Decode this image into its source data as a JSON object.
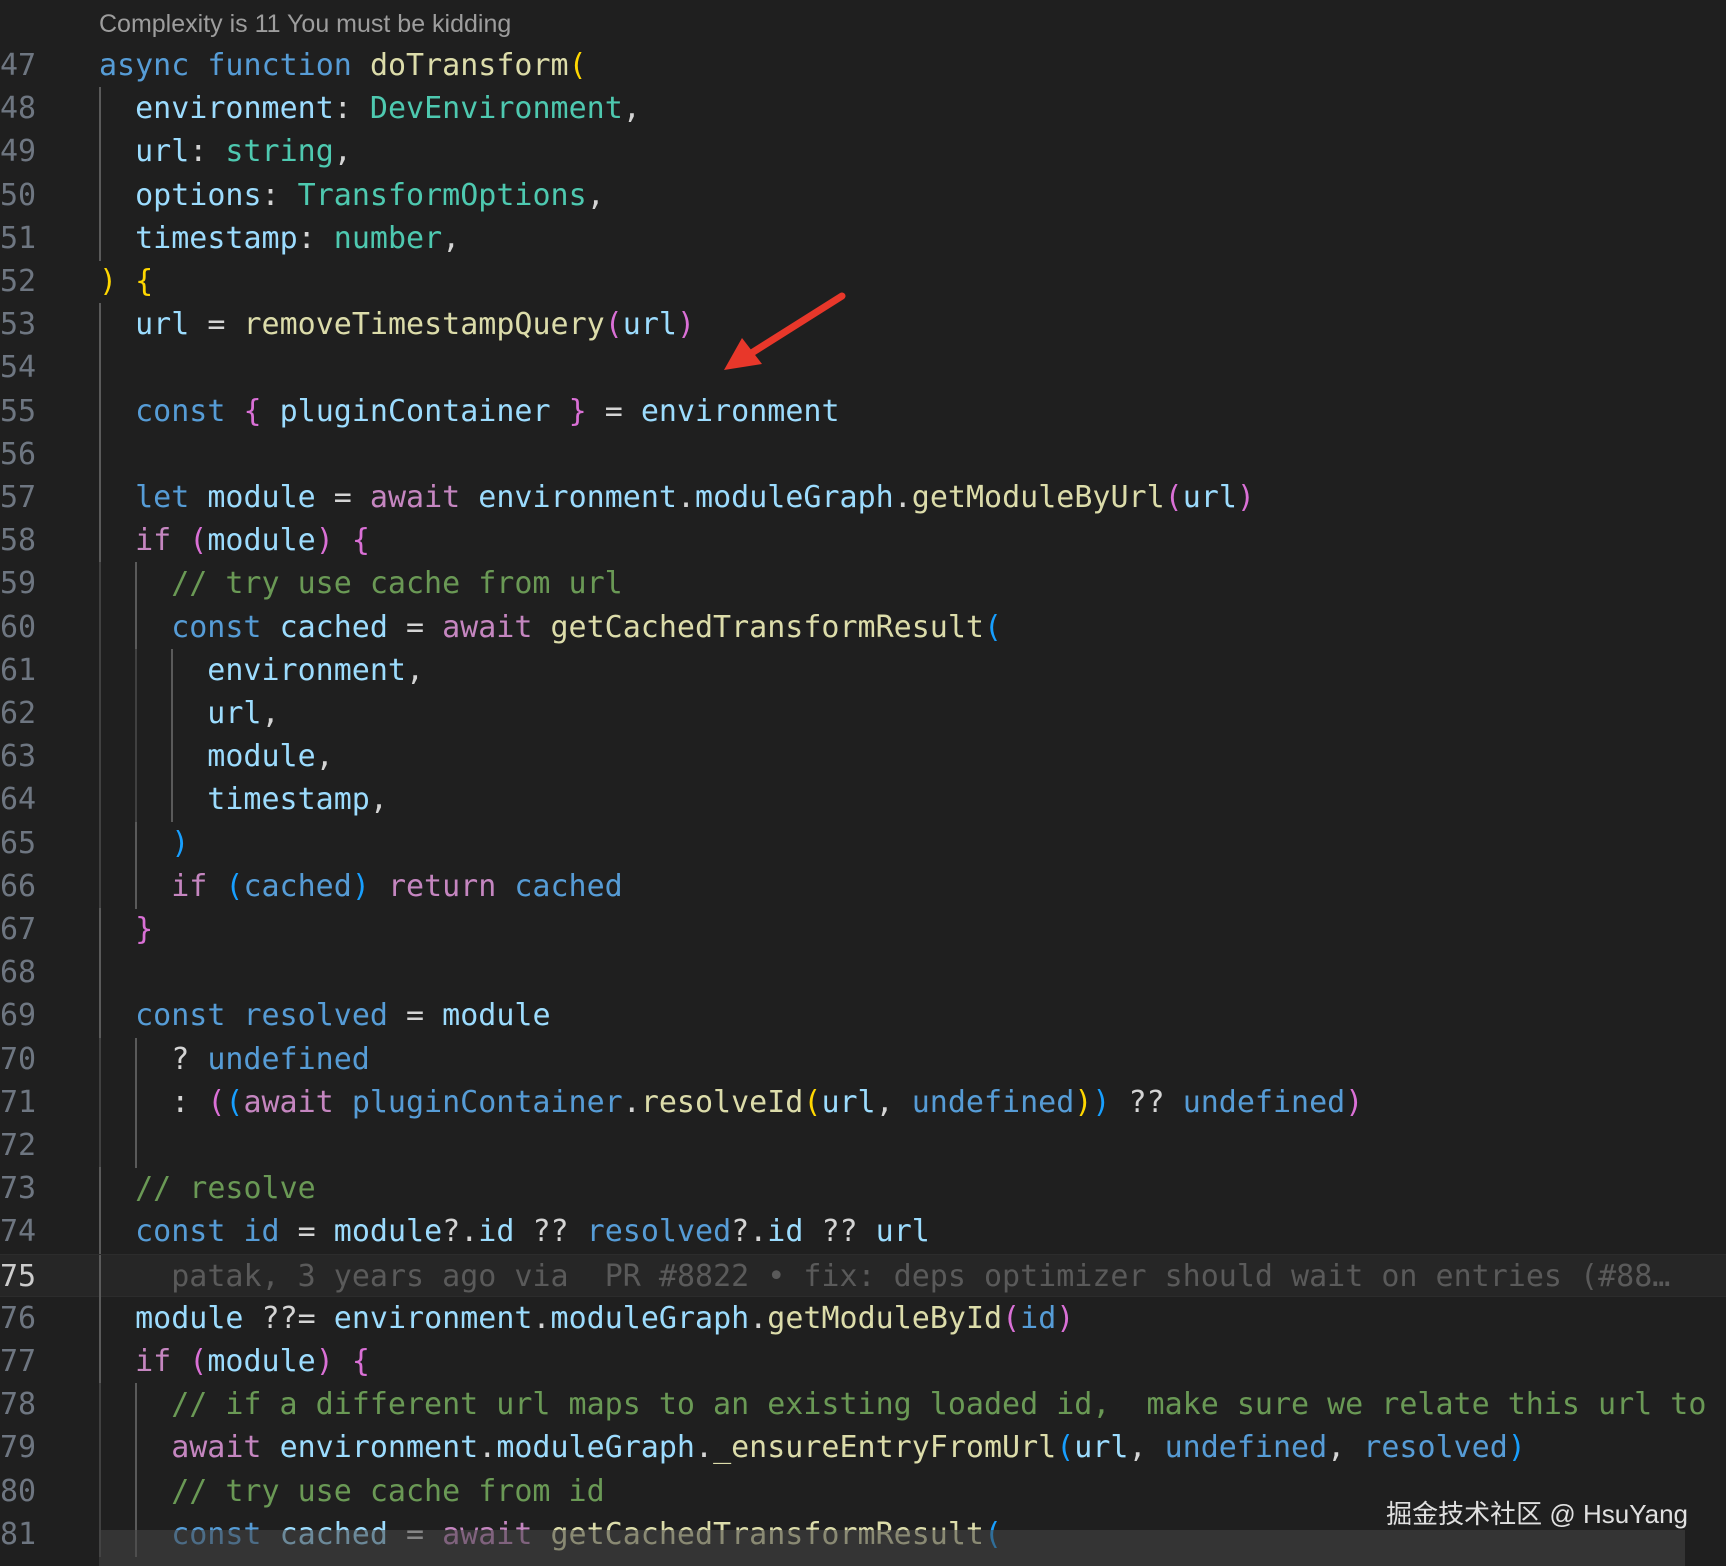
{
  "codelens": "Complexity is 11 You must be kidding",
  "active_line": 75,
  "watermark": "掘金技术社区 @ HsuYang",
  "colors": {
    "background": "#1f1f1f",
    "keyword": "#569cd6",
    "control": "#c586c0",
    "function": "#dcdcaa",
    "type": "#4ec9b0",
    "variable": "#9cdcfe",
    "comment": "#6a9955",
    "plain": "#d4d4d4",
    "bracket_gold": "#ffd700",
    "bracket_pink": "#da70d6",
    "bracket_blue": "#179fff",
    "arrow": "#e8372a"
  },
  "lines": [
    {
      "n": 47,
      "indent": 0,
      "tokens": [
        {
          "t": "async",
          "c": "keyword"
        },
        {
          "t": " ",
          "c": "plain"
        },
        {
          "t": "function",
          "c": "keyword"
        },
        {
          "t": " ",
          "c": "plain"
        },
        {
          "t": "doTransform",
          "c": "function"
        },
        {
          "t": "(",
          "c": "bracket_gold"
        }
      ]
    },
    {
      "n": 48,
      "indent": 1,
      "tokens": [
        {
          "t": "environment",
          "c": "variable"
        },
        {
          "t": ": ",
          "c": "plain"
        },
        {
          "t": "DevEnvironment",
          "c": "type"
        },
        {
          "t": ",",
          "c": "plain"
        }
      ]
    },
    {
      "n": 49,
      "indent": 1,
      "tokens": [
        {
          "t": "url",
          "c": "variable"
        },
        {
          "t": ": ",
          "c": "plain"
        },
        {
          "t": "string",
          "c": "type"
        },
        {
          "t": ",",
          "c": "plain"
        }
      ]
    },
    {
      "n": 50,
      "indent": 1,
      "tokens": [
        {
          "t": "options",
          "c": "variable"
        },
        {
          "t": ": ",
          "c": "plain"
        },
        {
          "t": "TransformOptions",
          "c": "type"
        },
        {
          "t": ",",
          "c": "plain"
        }
      ]
    },
    {
      "n": 51,
      "indent": 1,
      "tokens": [
        {
          "t": "timestamp",
          "c": "variable"
        },
        {
          "t": ": ",
          "c": "plain"
        },
        {
          "t": "number",
          "c": "type"
        },
        {
          "t": ",",
          "c": "plain"
        }
      ]
    },
    {
      "n": 52,
      "indent": 0,
      "tokens": [
        {
          "t": ")",
          "c": "bracket_gold"
        },
        {
          "t": " ",
          "c": "plain"
        },
        {
          "t": "{",
          "c": "bracket_gold"
        }
      ]
    },
    {
      "n": 53,
      "indent": 1,
      "tokens": [
        {
          "t": "url",
          "c": "variable"
        },
        {
          "t": " = ",
          "c": "plain"
        },
        {
          "t": "removeTimestampQuery",
          "c": "function"
        },
        {
          "t": "(",
          "c": "bracket_pink"
        },
        {
          "t": "url",
          "c": "variable"
        },
        {
          "t": ")",
          "c": "bracket_pink"
        }
      ]
    },
    {
      "n": 54,
      "indent": 1,
      "tokens": []
    },
    {
      "n": 55,
      "indent": 1,
      "tokens": [
        {
          "t": "const",
          "c": "keyword"
        },
        {
          "t": " ",
          "c": "plain"
        },
        {
          "t": "{",
          "c": "bracket_pink"
        },
        {
          "t": " pluginContainer ",
          "c": "variable"
        },
        {
          "t": "}",
          "c": "bracket_pink"
        },
        {
          "t": " = ",
          "c": "plain"
        },
        {
          "t": "environment",
          "c": "variable"
        }
      ]
    },
    {
      "n": 56,
      "indent": 1,
      "tokens": []
    },
    {
      "n": 57,
      "indent": 1,
      "tokens": [
        {
          "t": "let",
          "c": "keyword"
        },
        {
          "t": " ",
          "c": "plain"
        },
        {
          "t": "module",
          "c": "variable"
        },
        {
          "t": " = ",
          "c": "plain"
        },
        {
          "t": "await",
          "c": "control"
        },
        {
          "t": " ",
          "c": "plain"
        },
        {
          "t": "environment",
          "c": "variable"
        },
        {
          "t": ".",
          "c": "plain"
        },
        {
          "t": "moduleGraph",
          "c": "variable"
        },
        {
          "t": ".",
          "c": "plain"
        },
        {
          "t": "getModuleByUrl",
          "c": "function"
        },
        {
          "t": "(",
          "c": "bracket_pink"
        },
        {
          "t": "url",
          "c": "variable"
        },
        {
          "t": ")",
          "c": "bracket_pink"
        }
      ]
    },
    {
      "n": 58,
      "indent": 1,
      "tokens": [
        {
          "t": "if",
          "c": "control"
        },
        {
          "t": " ",
          "c": "plain"
        },
        {
          "t": "(",
          "c": "bracket_pink"
        },
        {
          "t": "module",
          "c": "variable"
        },
        {
          "t": ")",
          "c": "bracket_pink"
        },
        {
          "t": " ",
          "c": "plain"
        },
        {
          "t": "{",
          "c": "bracket_pink"
        }
      ]
    },
    {
      "n": 59,
      "indent": 2,
      "tokens": [
        {
          "t": "// try use cache from url",
          "c": "comment"
        }
      ]
    },
    {
      "n": 60,
      "indent": 2,
      "tokens": [
        {
          "t": "const",
          "c": "keyword"
        },
        {
          "t": " ",
          "c": "plain"
        },
        {
          "t": "cached",
          "c": "variable"
        },
        {
          "t": " = ",
          "c": "plain"
        },
        {
          "t": "await",
          "c": "control"
        },
        {
          "t": " ",
          "c": "plain"
        },
        {
          "t": "getCachedTransformResult",
          "c": "function"
        },
        {
          "t": "(",
          "c": "bracket_blue"
        }
      ]
    },
    {
      "n": 61,
      "indent": 3,
      "tokens": [
        {
          "t": "environment",
          "c": "variable"
        },
        {
          "t": ",",
          "c": "plain"
        }
      ]
    },
    {
      "n": 62,
      "indent": 3,
      "tokens": [
        {
          "t": "url",
          "c": "variable"
        },
        {
          "t": ",",
          "c": "plain"
        }
      ]
    },
    {
      "n": 63,
      "indent": 3,
      "tokens": [
        {
          "t": "module",
          "c": "variable"
        },
        {
          "t": ",",
          "c": "plain"
        }
      ]
    },
    {
      "n": 64,
      "indent": 3,
      "tokens": [
        {
          "t": "timestamp",
          "c": "variable"
        },
        {
          "t": ",",
          "c": "plain"
        }
      ]
    },
    {
      "n": 65,
      "indent": 2,
      "tokens": [
        {
          "t": ")",
          "c": "bracket_blue"
        }
      ]
    },
    {
      "n": 66,
      "indent": 2,
      "tokens": [
        {
          "t": "if",
          "c": "control"
        },
        {
          "t": " ",
          "c": "plain"
        },
        {
          "t": "(",
          "c": "bracket_blue"
        },
        {
          "t": "cached",
          "c": "keyword"
        },
        {
          "t": ")",
          "c": "bracket_blue"
        },
        {
          "t": " ",
          "c": "plain"
        },
        {
          "t": "return",
          "c": "control"
        },
        {
          "t": " ",
          "c": "plain"
        },
        {
          "t": "cached",
          "c": "keyword"
        }
      ]
    },
    {
      "n": 67,
      "indent": 1,
      "tokens": [
        {
          "t": "}",
          "c": "bracket_pink"
        }
      ]
    },
    {
      "n": 68,
      "indent": 1,
      "tokens": []
    },
    {
      "n": 69,
      "indent": 1,
      "tokens": [
        {
          "t": "const",
          "c": "keyword"
        },
        {
          "t": " ",
          "c": "plain"
        },
        {
          "t": "resolved",
          "c": "keyword"
        },
        {
          "t": " = ",
          "c": "plain"
        },
        {
          "t": "module",
          "c": "variable"
        }
      ]
    },
    {
      "n": 70,
      "indent": 2,
      "tokens": [
        {
          "t": "? ",
          "c": "plain"
        },
        {
          "t": "undefined",
          "c": "keyword"
        }
      ]
    },
    {
      "n": 71,
      "indent": 2,
      "tokens": [
        {
          "t": ": ",
          "c": "plain"
        },
        {
          "t": "(",
          "c": "bracket_pink"
        },
        {
          "t": "(",
          "c": "bracket_blue"
        },
        {
          "t": "await",
          "c": "control"
        },
        {
          "t": " ",
          "c": "plain"
        },
        {
          "t": "pluginContainer",
          "c": "keyword"
        },
        {
          "t": ".",
          "c": "plain"
        },
        {
          "t": "resolveId",
          "c": "function"
        },
        {
          "t": "(",
          "c": "bracket_gold"
        },
        {
          "t": "url",
          "c": "variable"
        },
        {
          "t": ", ",
          "c": "plain"
        },
        {
          "t": "undefined",
          "c": "keyword"
        },
        {
          "t": ")",
          "c": "bracket_gold"
        },
        {
          "t": ")",
          "c": "bracket_blue"
        },
        {
          "t": " ?? ",
          "c": "plain"
        },
        {
          "t": "undefined",
          "c": "keyword"
        },
        {
          "t": ")",
          "c": "bracket_pink"
        }
      ]
    },
    {
      "n": 72,
      "indent": 2,
      "tokens": []
    },
    {
      "n": 73,
      "indent": 1,
      "tokens": [
        {
          "t": "// resolve",
          "c": "comment"
        }
      ]
    },
    {
      "n": 74,
      "indent": 1,
      "tokens": [
        {
          "t": "const",
          "c": "keyword"
        },
        {
          "t": " ",
          "c": "plain"
        },
        {
          "t": "id",
          "c": "keyword"
        },
        {
          "t": " = ",
          "c": "plain"
        },
        {
          "t": "module",
          "c": "variable"
        },
        {
          "t": "?.",
          "c": "plain"
        },
        {
          "t": "id",
          "c": "variable"
        },
        {
          "t": " ?? ",
          "c": "plain"
        },
        {
          "t": "resolved",
          "c": "keyword"
        },
        {
          "t": "?.",
          "c": "plain"
        },
        {
          "t": "id",
          "c": "variable"
        },
        {
          "t": " ?? ",
          "c": "plain"
        },
        {
          "t": "url",
          "c": "variable"
        }
      ]
    },
    {
      "n": 75,
      "indent": 1,
      "tokens": [
        {
          "t": "  patak, 3 years ago via  PR #8822 • fix: deps optimizer should wait on entries (#88…",
          "c": "blame"
        }
      ]
    },
    {
      "n": 76,
      "indent": 1,
      "tokens": [
        {
          "t": "module",
          "c": "variable"
        },
        {
          "t": " ??= ",
          "c": "plain"
        },
        {
          "t": "environment",
          "c": "variable"
        },
        {
          "t": ".",
          "c": "plain"
        },
        {
          "t": "moduleGraph",
          "c": "variable"
        },
        {
          "t": ".",
          "c": "plain"
        },
        {
          "t": "getModuleById",
          "c": "function"
        },
        {
          "t": "(",
          "c": "bracket_pink"
        },
        {
          "t": "id",
          "c": "keyword"
        },
        {
          "t": ")",
          "c": "bracket_pink"
        }
      ]
    },
    {
      "n": 77,
      "indent": 1,
      "tokens": [
        {
          "t": "if",
          "c": "control"
        },
        {
          "t": " ",
          "c": "plain"
        },
        {
          "t": "(",
          "c": "bracket_pink"
        },
        {
          "t": "module",
          "c": "variable"
        },
        {
          "t": ")",
          "c": "bracket_pink"
        },
        {
          "t": " ",
          "c": "plain"
        },
        {
          "t": "{",
          "c": "bracket_pink"
        }
      ]
    },
    {
      "n": 78,
      "indent": 2,
      "tokens": [
        {
          "t": "// if a different url maps to an existing loaded id,  make sure we relate this url to the",
          "c": "comment"
        }
      ]
    },
    {
      "n": 79,
      "indent": 2,
      "tokens": [
        {
          "t": "await",
          "c": "control"
        },
        {
          "t": " ",
          "c": "plain"
        },
        {
          "t": "environment",
          "c": "variable"
        },
        {
          "t": ".",
          "c": "plain"
        },
        {
          "t": "moduleGraph",
          "c": "variable"
        },
        {
          "t": ".",
          "c": "plain"
        },
        {
          "t": "_ensureEntryFromUrl",
          "c": "function"
        },
        {
          "t": "(",
          "c": "bracket_blue"
        },
        {
          "t": "url",
          "c": "variable"
        },
        {
          "t": ", ",
          "c": "plain"
        },
        {
          "t": "undefined",
          "c": "keyword"
        },
        {
          "t": ", ",
          "c": "plain"
        },
        {
          "t": "resolved",
          "c": "keyword"
        },
        {
          "t": ")",
          "c": "bracket_blue"
        }
      ]
    },
    {
      "n": 80,
      "indent": 2,
      "tokens": [
        {
          "t": "// try use cache from id",
          "c": "comment"
        }
      ]
    },
    {
      "n": 81,
      "indent": 2,
      "tokens": [
        {
          "t": "const",
          "c": "keyword"
        },
        {
          "t": " ",
          "c": "plain"
        },
        {
          "t": "cached",
          "c": "variable"
        },
        {
          "t": " = ",
          "c": "plain"
        },
        {
          "t": "await",
          "c": "control"
        },
        {
          "t": " ",
          "c": "plain"
        },
        {
          "t": "getCachedTransformResult",
          "c": "function"
        },
        {
          "t": "(",
          "c": "bracket_blue"
        }
      ]
    }
  ]
}
